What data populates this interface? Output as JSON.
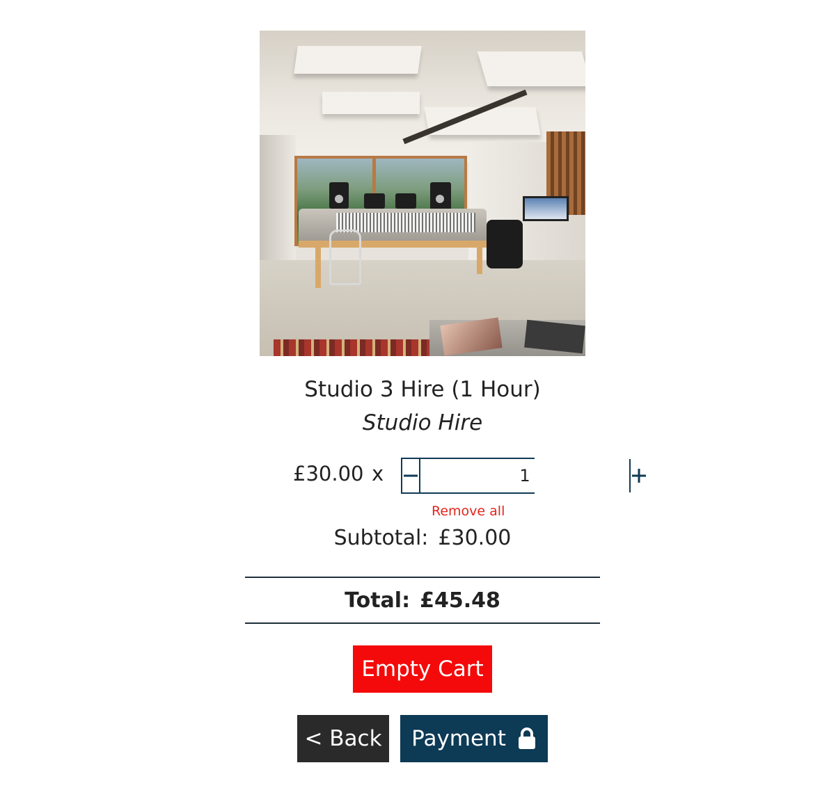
{
  "product": {
    "image_alt": "Studio 3 recording room",
    "title": "Studio 3 Hire (1 Hour)",
    "category": "Studio Hire",
    "price": "£30.00",
    "times": "x",
    "quantity": "1",
    "remove_label": "Remove all",
    "subtotal_label": "Subtotal:",
    "subtotal_value": "£30.00"
  },
  "cart": {
    "total_label": "Total:",
    "total_value": "£45.48"
  },
  "buttons": {
    "empty_cart": "Empty Cart",
    "back": "< Back",
    "payment": "Payment"
  },
  "icons": {
    "minus": "minus-icon",
    "plus": "plus-icon",
    "lock": "lock-icon"
  },
  "colors": {
    "accent_navy": "#0d3a55",
    "danger_red": "#f40a0a",
    "remove_red": "#e1261c",
    "back_dark": "#2a2a2a"
  }
}
